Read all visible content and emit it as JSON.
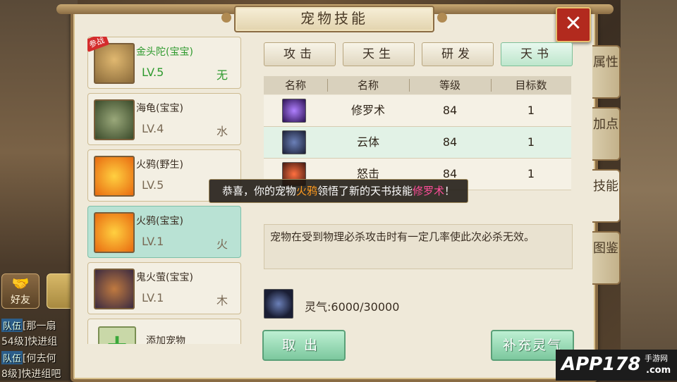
{
  "chat": {
    "friend_label": "好友",
    "lines": [
      {
        "tag": "队伍",
        "text": "[那一扇"
      },
      {
        "tag": "",
        "text": "54级]快进组"
      },
      {
        "tag": "队伍",
        "text": "[何去何"
      },
      {
        "tag": "",
        "text": "8级]快进组吧"
      }
    ]
  },
  "panel": {
    "title": "宠物技能",
    "close": "✕"
  },
  "pets": [
    {
      "badge": "参战",
      "name": "金头陀(宝宝)",
      "level": "LV.5",
      "element": "无"
    },
    {
      "name": "海龟(宝宝)",
      "level": "LV.4",
      "element": "水"
    },
    {
      "name": "火鸦(野生)",
      "level": "LV.5",
      "element": ""
    },
    {
      "name": "火鸦(宝宝)",
      "level": "LV.1",
      "element": "火"
    },
    {
      "name": "鬼火萤(宝宝)",
      "level": "LV.1",
      "element": "木"
    },
    {
      "name": "添加宠物"
    }
  ],
  "tabs": [
    "攻击",
    "天生",
    "研发",
    "天书"
  ],
  "side_tabs": [
    "属性",
    "加点",
    "技能",
    "图鉴"
  ],
  "table": {
    "headers": [
      "名称",
      "名称",
      "等级",
      "目标数"
    ],
    "rows": [
      {
        "name": "修罗术",
        "level": "84",
        "targets": "1"
      },
      {
        "name": "云体",
        "level": "84",
        "targets": "1"
      },
      {
        "name": "怒击",
        "level": "84",
        "targets": "1"
      }
    ]
  },
  "toast": {
    "prefix": "恭喜，你的宠物",
    "pet": "火鸦",
    "middle": "领悟了新的天书技能",
    "skill": "修罗术",
    "suffix": "！"
  },
  "description": "宠物在受到物理必杀攻击时有一定几率使此次必杀无效。",
  "spirit": "灵气:6000/30000",
  "buttons": {
    "take_out": "取出",
    "refill": "补充灵气"
  },
  "watermark": {
    "brand": "APP178",
    "sub1": "手游网",
    "sub2": ".com"
  }
}
